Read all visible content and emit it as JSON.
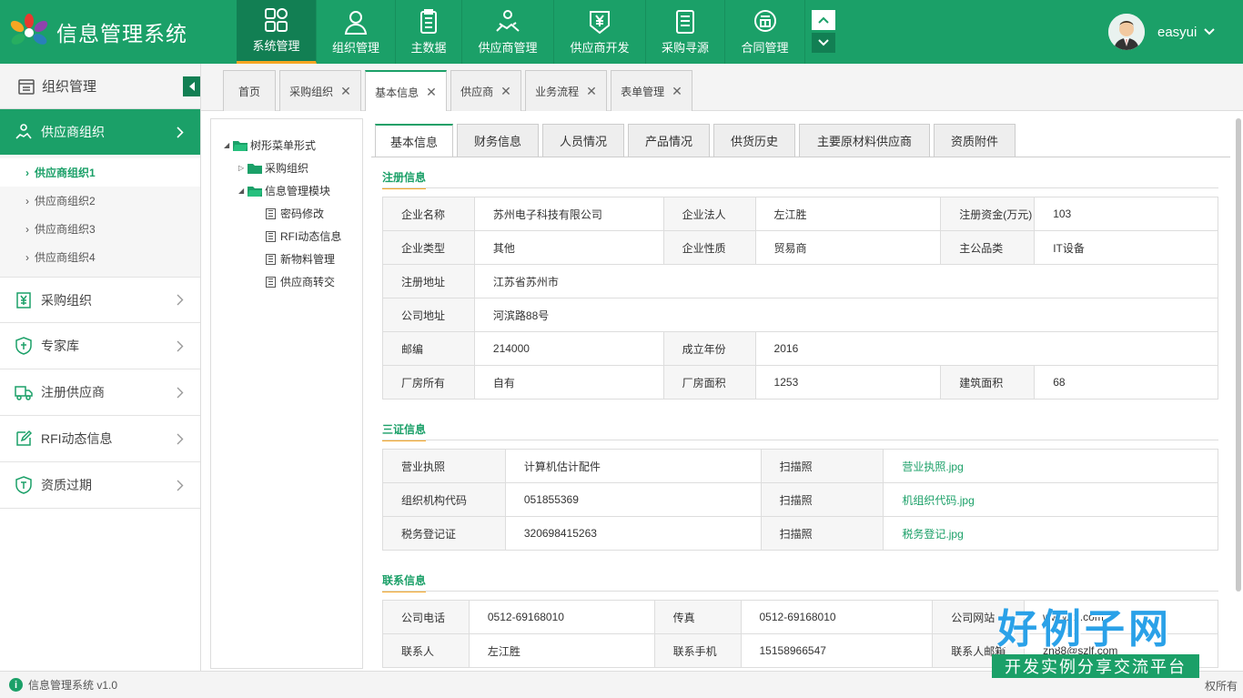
{
  "app": {
    "title": "信息管理系统"
  },
  "nav": {
    "items": [
      {
        "label": "系统管理",
        "icon": "grid-icon",
        "active": true
      },
      {
        "label": "组织管理",
        "icon": "user-icon",
        "active": false
      },
      {
        "label": "主数据",
        "icon": "clipboard-icon",
        "active": false
      },
      {
        "label": "供应商管理",
        "icon": "handshake-icon",
        "active": false
      },
      {
        "label": "供应商开发",
        "icon": "yen-badge-icon",
        "active": false
      },
      {
        "label": "采购寻源",
        "icon": "document-icon",
        "active": false
      },
      {
        "label": "合同管理",
        "icon": "contract-icon",
        "active": false
      }
    ]
  },
  "user": {
    "name": "easyui"
  },
  "sidebar": {
    "header": "组织管理",
    "active": {
      "label": "供应商组织"
    },
    "sub_items": [
      "供应商组织1",
      "供应商组织2",
      "供应商组织3",
      "供应商组织4"
    ],
    "items": [
      {
        "label": "采购组织",
        "icon": "yen-doc-icon"
      },
      {
        "label": "专家库",
        "icon": "shield-expert-icon"
      },
      {
        "label": "注册供应商",
        "icon": "truck-icon"
      },
      {
        "label": "RFI动态信息",
        "icon": "edit-icon"
      },
      {
        "label": "资质过期",
        "icon": "shield-icon"
      }
    ]
  },
  "tabs": [
    {
      "label": "首页",
      "closable": false
    },
    {
      "label": "采购组织",
      "closable": true
    },
    {
      "label": "基本信息",
      "closable": true,
      "active": true
    },
    {
      "label": "供应商",
      "closable": true
    },
    {
      "label": "业务流程",
      "closable": true
    },
    {
      "label": "表单管理",
      "closable": true
    }
  ],
  "tree": {
    "root": "树形菜单形式",
    "nodes": [
      {
        "label": "采购组织"
      },
      {
        "label": "信息管理模块",
        "children": [
          "密码修改",
          "RFI动态信息",
          "新物料管理",
          "供应商转交"
        ]
      }
    ]
  },
  "inner_tabs": [
    "基本信息",
    "财务信息",
    "人员情况",
    "产品情况",
    "供货历史",
    "主要原材料供应商",
    "资质附件"
  ],
  "sections": {
    "reg": {
      "title": "注册信息",
      "rows": [
        [
          "企业名称",
          "苏州电子科技有限公司",
          "企业法人",
          "左江胜",
          "注册资金(万元)",
          "103"
        ],
        [
          "企业类型",
          "其他",
          "企业性质",
          "贸易商",
          "主公品类",
          "IT设备"
        ],
        [
          "注册地址",
          "江苏省苏州市"
        ],
        [
          "公司地址",
          "河滨路88号"
        ],
        [
          "邮编",
          "214000",
          "成立年份",
          "2016"
        ],
        [
          "厂房所有",
          "自有",
          "厂房面积",
          "1253",
          "建筑面积",
          "68"
        ]
      ]
    },
    "cert": {
      "title": "三证信息",
      "rows": [
        [
          "营业执照",
          "计算机估计配件",
          "扫描照",
          "营业执照.jpg"
        ],
        [
          "组织机构代码",
          "051855369",
          "扫描照",
          "机组织代码.jpg"
        ],
        [
          "税务登记证",
          "320698415263",
          "扫描照",
          "税务登记.jpg"
        ]
      ]
    },
    "contact": {
      "title": "联系信息",
      "rows": [
        [
          "公司电话",
          "0512-69168010",
          "传真",
          "0512-69168010",
          "公司网站",
          "www.zlf.com"
        ],
        [
          "联系人",
          "左江胜",
          "联系手机",
          "15158966547",
          "联系人邮箱",
          "zh88@szlf.com"
        ]
      ]
    }
  },
  "status": {
    "left": "信息管理系统 v1.0",
    "right": "权所有"
  },
  "watermark": {
    "big": "好例子网",
    "small": "开发实例分享交流平台"
  },
  "colors": {
    "primary": "#1ba068",
    "accent": "#f5a623",
    "watermark": "#2aa1e8"
  }
}
